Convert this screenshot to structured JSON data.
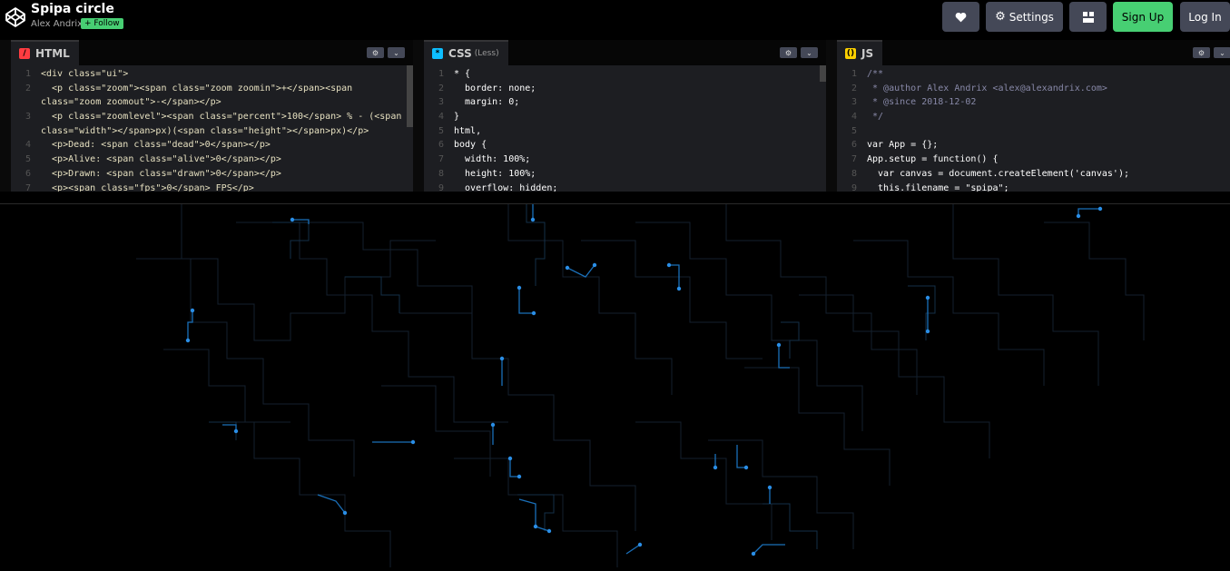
{
  "header": {
    "title": "Spipa circle",
    "author": "Alex Andrix",
    "follow_label": "+ Follow",
    "buttons": {
      "settings": "Settings",
      "signup": "Sign Up",
      "login": "Log In"
    }
  },
  "editors": {
    "html": {
      "label": "HTML",
      "icon": "html-icon",
      "color": "#ff3c41",
      "lines": [
        {
          "n": "1",
          "t": "<div class=\"ui\">"
        },
        {
          "n": "2",
          "t": "  <p class=\"zoom\"><span class=\"zoom zoomin\">+</span><span"
        },
        {
          "n": "",
          "t": "class=\"zoom zoomout\">-</span></p>"
        },
        {
          "n": "3",
          "t": "  <p class=\"zoomlevel\"><span class=\"percent\">100</span> % - (<span"
        },
        {
          "n": "",
          "t": "class=\"width\"></span>px)(<span class=\"height\"></span>px)</p>"
        },
        {
          "n": "4",
          "t": "  <p>Dead: <span class=\"dead\">0</span></p>"
        },
        {
          "n": "5",
          "t": "  <p>Alive: <span class=\"alive\">0</span></p>"
        },
        {
          "n": "6",
          "t": "  <p>Drawn: <span class=\"drawn\">0</span></p>"
        },
        {
          "n": "7",
          "t": "  <p><span class=\"fps\">0</span> FPS</p>"
        }
      ]
    },
    "css": {
      "label": "CSS",
      "sublabel": "(Less)",
      "icon": "css-icon",
      "color": "#0ebeff",
      "lines": [
        {
          "n": "1",
          "t": "* {"
        },
        {
          "n": "2",
          "t": "  border: none;"
        },
        {
          "n": "3",
          "t": "  margin: 0;"
        },
        {
          "n": "4",
          "t": "}"
        },
        {
          "n": "5",
          "t": "html,"
        },
        {
          "n": "6",
          "t": "body {"
        },
        {
          "n": "7",
          "t": "  width: 100%;"
        },
        {
          "n": "8",
          "t": "  height: 100%;"
        },
        {
          "n": "9",
          "t": "  overflow: hidden;"
        }
      ]
    },
    "js": {
      "label": "JS",
      "icon": "js-icon",
      "color": "#fcd000",
      "lines": [
        {
          "n": "1",
          "t": "/**"
        },
        {
          "n": "2",
          "t": " * @author Alex Andrix <alex@alexandrix.com>"
        },
        {
          "n": "3",
          "t": " * @since 2018-12-02"
        },
        {
          "n": "4",
          "t": " */"
        },
        {
          "n": "5",
          "t": ""
        },
        {
          "n": "6",
          "t": "var App = {};"
        },
        {
          "n": "7",
          "t": "App.setup = function() {"
        },
        {
          "n": "8",
          "t": "  var canvas = document.createElement('canvas');"
        },
        {
          "n": "9",
          "t": "  this.filename = \"spipa\";"
        }
      ]
    }
  }
}
